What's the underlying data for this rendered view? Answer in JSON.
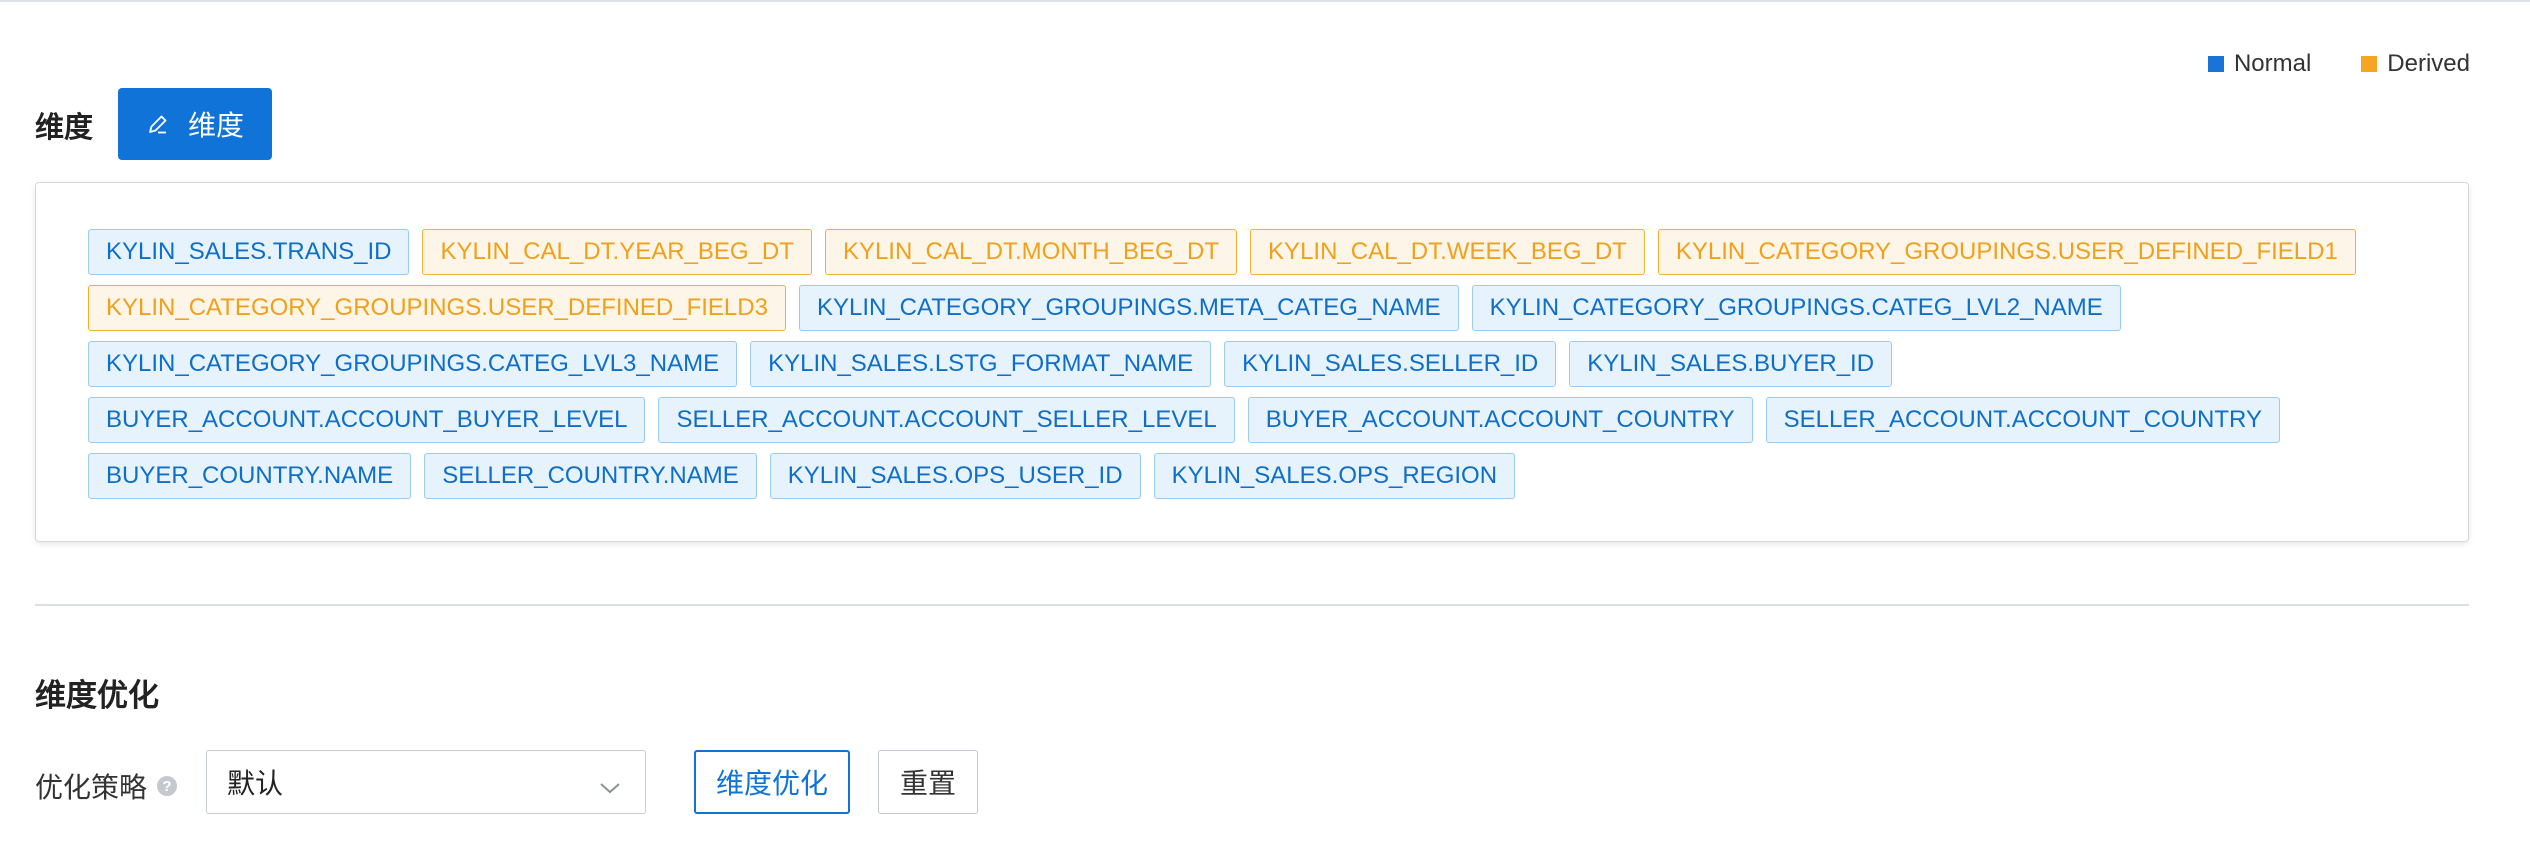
{
  "legend": {
    "items": [
      {
        "label": "Normal",
        "color": "#1a73d8"
      },
      {
        "label": "Derived",
        "color": "#f4a623"
      }
    ]
  },
  "dimensions": {
    "title": "维度",
    "edit_button_label": "维度",
    "edit_button_icon": "pencil-icon",
    "tags": [
      {
        "label": "KYLIN_SALES.TRANS_ID",
        "type": "normal"
      },
      {
        "label": "KYLIN_CAL_DT.YEAR_BEG_DT",
        "type": "derived"
      },
      {
        "label": "KYLIN_CAL_DT.MONTH_BEG_DT",
        "type": "derived"
      },
      {
        "label": "KYLIN_CAL_DT.WEEK_BEG_DT",
        "type": "derived"
      },
      {
        "label": "KYLIN_CATEGORY_GROUPINGS.USER_DEFINED_FIELD1",
        "type": "derived"
      },
      {
        "label": "KYLIN_CATEGORY_GROUPINGS.USER_DEFINED_FIELD3",
        "type": "derived"
      },
      {
        "label": "KYLIN_CATEGORY_GROUPINGS.META_CATEG_NAME",
        "type": "normal"
      },
      {
        "label": "KYLIN_CATEGORY_GROUPINGS.CATEG_LVL2_NAME",
        "type": "normal"
      },
      {
        "label": "KYLIN_CATEGORY_GROUPINGS.CATEG_LVL3_NAME",
        "type": "normal"
      },
      {
        "label": "KYLIN_SALES.LSTG_FORMAT_NAME",
        "type": "normal"
      },
      {
        "label": "KYLIN_SALES.SELLER_ID",
        "type": "normal"
      },
      {
        "label": "KYLIN_SALES.BUYER_ID",
        "type": "normal"
      },
      {
        "label": "BUYER_ACCOUNT.ACCOUNT_BUYER_LEVEL",
        "type": "normal"
      },
      {
        "label": "SELLER_ACCOUNT.ACCOUNT_SELLER_LEVEL",
        "type": "normal"
      },
      {
        "label": "BUYER_ACCOUNT.ACCOUNT_COUNTRY",
        "type": "normal"
      },
      {
        "label": "SELLER_ACCOUNT.ACCOUNT_COUNTRY",
        "type": "normal"
      },
      {
        "label": "BUYER_COUNTRY.NAME",
        "type": "normal"
      },
      {
        "label": "SELLER_COUNTRY.NAME",
        "type": "normal"
      },
      {
        "label": "KYLIN_SALES.OPS_USER_ID",
        "type": "normal"
      },
      {
        "label": "KYLIN_SALES.OPS_REGION",
        "type": "normal"
      }
    ]
  },
  "optimization": {
    "title": "维度优化",
    "strategy_label": "优化策略",
    "help_icon": "question-circle-icon",
    "strategy_value": "默认",
    "optimize_button": "维度优化",
    "reset_button": "重置"
  }
}
